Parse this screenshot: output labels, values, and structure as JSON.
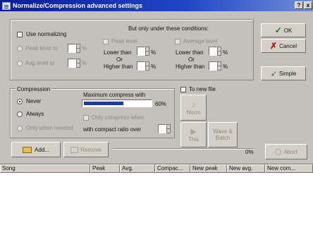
{
  "window": {
    "title": "Normalize/Compression advanced settings",
    "help_btn": "?",
    "close_btn": "x"
  },
  "normalize": {
    "use_label": "Use normalizing",
    "condition_title": "But only under these conditions:",
    "peak_level": "Peak level to",
    "avg_level": "Avg level to",
    "peak_label": "Peak level",
    "average_label": "Average level",
    "lower_than": "Lower than",
    "or": "Or",
    "higher_than": "Higher than",
    "percent": "%"
  },
  "compression": {
    "title": "Compression",
    "never": "Never",
    "always": "Always",
    "only_needed": "Only when needed",
    "max_label": "Maximum compress with",
    "max_value": "60%",
    "level_fraction": 0.6,
    "only_compress_label": "Only compress when",
    "ratio_label": "with compact ratio over"
  },
  "buttons": {
    "ok": "OK",
    "cancel": "Cancel",
    "simple": "Simple",
    "to_new_file": "To new file",
    "norm": "Norm",
    "this": "This",
    "wave_batch": "Wave & Batch",
    "add": "Add...",
    "remove": "Remove",
    "abort": "Abort",
    "progress": "0%"
  },
  "table": {
    "columns": [
      "Song",
      "Peak",
      "Avg.",
      "Compac...",
      "New peak",
      "New avg.",
      "New com..."
    ]
  },
  "colors": {
    "titlebar": "#0a1a9a",
    "face": "#d4d0c8",
    "progress": "#1d3aa8"
  }
}
